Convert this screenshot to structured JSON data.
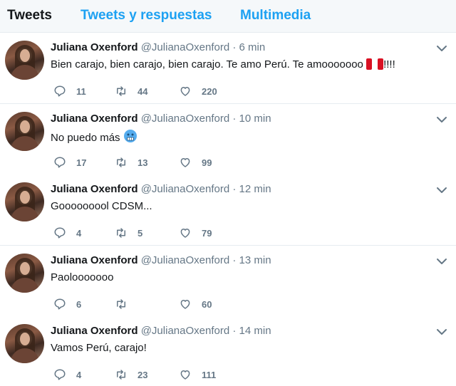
{
  "tabs": [
    {
      "label": "Tweets",
      "active": true
    },
    {
      "label": "Tweets y respuestas",
      "active": false
    },
    {
      "label": "Multimedia",
      "active": false
    }
  ],
  "colors": {
    "accent": "#1da1f2",
    "muted": "#657786",
    "text": "#14171a",
    "divider": "#e6ecf0"
  },
  "tweets": [
    {
      "name": "Juliana Oxenford",
      "handle": "@JulianaOxenford",
      "dot": "·",
      "time": "6 min",
      "text": "Bien carajo, bien carajo, bien carajo. Te amo Perú. Te amooooooo",
      "emoji": "peru-flag",
      "text_after": "!!!!",
      "replies": "11",
      "retweets": "44",
      "likes": "220"
    },
    {
      "name": "Juliana Oxenford",
      "handle": "@JulianaOxenford",
      "dot": "·",
      "time": "10 min",
      "text": "No puedo más",
      "emoji": "cold-face",
      "text_after": "",
      "replies": "17",
      "retweets": "13",
      "likes": "99"
    },
    {
      "name": "Juliana Oxenford",
      "handle": "@JulianaOxenford",
      "dot": "·",
      "time": "12 min",
      "text": "Gooooooool CDSM...",
      "emoji": "",
      "text_after": "",
      "replies": "4",
      "retweets": "5",
      "likes": "79"
    },
    {
      "name": "Juliana Oxenford",
      "handle": "@JulianaOxenford",
      "dot": "·",
      "time": "13 min",
      "text": "Paolooooooo",
      "emoji": "",
      "text_after": "",
      "replies": "6",
      "retweets": "",
      "likes": "60"
    },
    {
      "name": "Juliana Oxenford",
      "handle": "@JulianaOxenford",
      "dot": "·",
      "time": "14 min",
      "text": "Vamos Perú, carajo!",
      "emoji": "",
      "text_after": "",
      "replies": "4",
      "retweets": "23",
      "likes": "111"
    }
  ]
}
